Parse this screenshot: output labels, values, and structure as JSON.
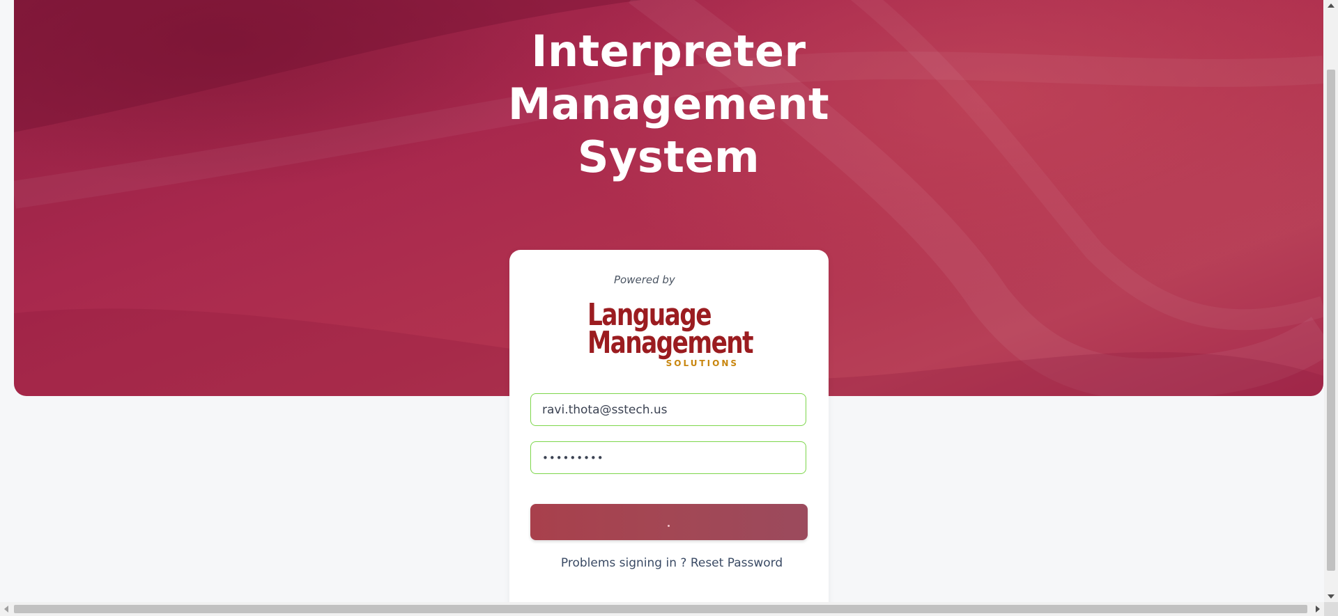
{
  "hero": {
    "title_lines": [
      "Interpreter",
      "Management",
      "System"
    ]
  },
  "login": {
    "powered_by": "Powered by",
    "logo": {
      "line1": "Language",
      "line2": "Management",
      "subtitle": "SOLUTIONS"
    },
    "email_value": "ravi.thota@sstech.us",
    "password_value": "•••••••••",
    "help_text": "Problems signing in ?",
    "reset_link": "Reset Password"
  },
  "colors": {
    "hero_accent": "#a8284d",
    "button": "#a34754",
    "field_border": "#7cd64a",
    "logo_red": "#9b1c20",
    "logo_gold": "#c8860e"
  },
  "icons": [
    "scroll-up-arrow-icon",
    "scroll-down-arrow-icon",
    "scroll-left-arrow-icon",
    "scroll-right-arrow-icon"
  ]
}
